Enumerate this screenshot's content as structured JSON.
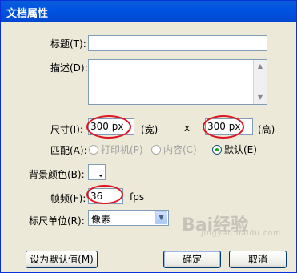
{
  "window": {
    "title": "文档属性"
  },
  "fields": {
    "title_label": "标题(T):",
    "desc_label": "描述(D):",
    "size_label": "尺寸(I):",
    "width_value": "300 px",
    "width_unit": "(宽)",
    "size_x": "x",
    "height_value": "300 px",
    "height_unit": "(高)",
    "match_label": "匹配(A):",
    "match_options": [
      "打印机(P)",
      "内容(C)",
      "默认(E)"
    ],
    "bg_color_label": "背景颜色(B):",
    "bg_color": "#ffffff",
    "frame_rate_label": "帧频(F):",
    "frame_rate_value": "36",
    "frame_rate_unit": "fps",
    "ruler_label": "标尺单位(R):",
    "ruler_value": "像素"
  },
  "buttons": {
    "set_default": "设为默认值(M)",
    "ok": "确定",
    "cancel": "取消"
  },
  "watermark": {
    "brand": "Bai经验",
    "url": "jingyan.baidu.com"
  },
  "colors": {
    "title_bar": "#0053e1",
    "dialog_bg": "#ece9d8",
    "highlight_ring": "#e0141e"
  }
}
